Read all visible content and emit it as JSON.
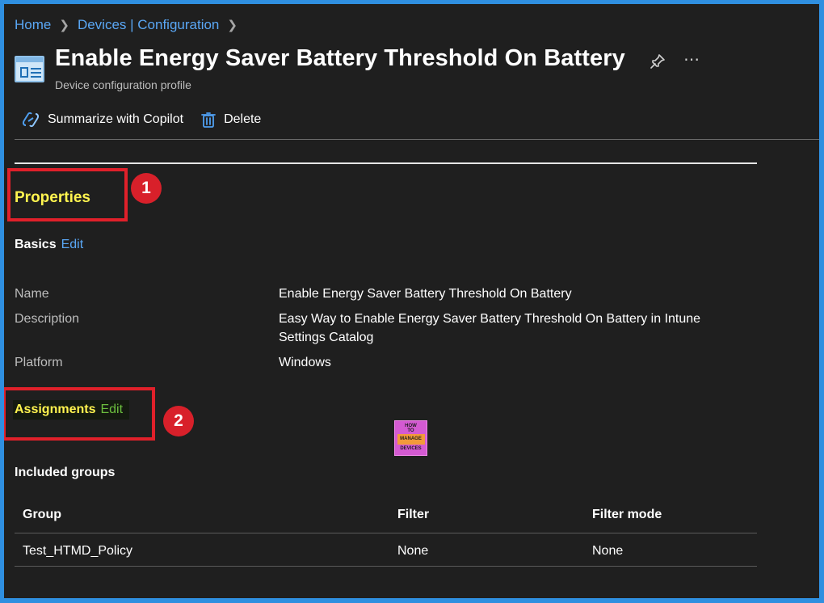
{
  "breadcrumb": {
    "items": [
      "Home",
      "Devices | Configuration"
    ]
  },
  "header": {
    "title": "Enable Energy Saver Battery Threshold On Battery",
    "subtitle": "Device configuration profile",
    "icon": "configuration-profile-icon",
    "pin_icon": "pin-icon",
    "more_icon": "more-options-icon"
  },
  "toolbar": {
    "copilot_label": "Summarize with Copilot",
    "delete_label": "Delete"
  },
  "annotations": {
    "marker1": "1",
    "marker2": "2",
    "highlight_color": "#e0202a"
  },
  "properties": {
    "title": "Properties",
    "basics_label": "Basics",
    "basics_edit": "Edit",
    "fields": [
      {
        "label": "Name",
        "value": "Enable Energy Saver Battery Threshold On Battery"
      },
      {
        "label": "Description",
        "value": "Easy Way to Enable Energy Saver Battery Threshold On Battery in Intune Settings Catalog"
      },
      {
        "label": "Platform",
        "value": "Windows"
      }
    ]
  },
  "assignments": {
    "label": "Assignments",
    "edit": "Edit",
    "included_title": "Included groups",
    "columns": [
      "Group",
      "Filter",
      "Filter mode"
    ],
    "rows": [
      {
        "group": "Test_HTMD_Policy",
        "filter": "None",
        "filter_mode": "None"
      }
    ]
  },
  "watermark": {
    "line1": "HOW",
    "line2": "TO",
    "line3": "MANAGE",
    "line4": "DEVICES"
  },
  "colors": {
    "accent": "#5aa7f5",
    "highlight_text": "#fff44f",
    "background": "#1f1f1f",
    "frame": "#2f8fe0"
  }
}
